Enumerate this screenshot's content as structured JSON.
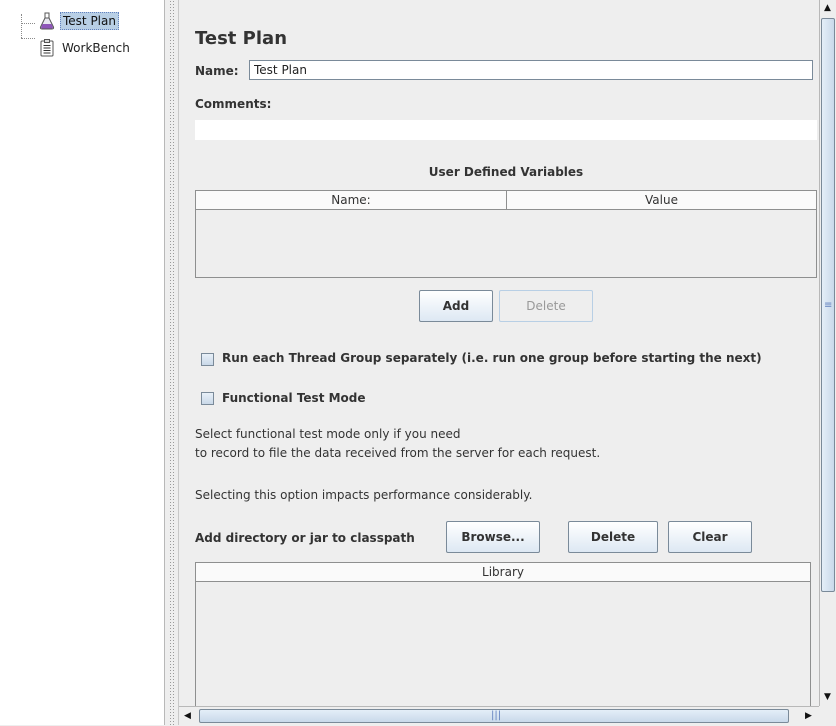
{
  "tree": {
    "items": [
      {
        "label": "Test Plan",
        "icon": "flask-icon",
        "selected": true
      },
      {
        "label": "WorkBench",
        "icon": "clipboard-icon",
        "selected": false
      }
    ]
  },
  "panel": {
    "title": "Test Plan",
    "name_label": "Name:",
    "name_value": "Test Plan",
    "comments_label": "Comments:",
    "comments_value": ""
  },
  "udv": {
    "title": "User Defined Variables",
    "columns": [
      "Name:",
      "Value"
    ],
    "rows": [],
    "add_label": "Add",
    "delete_label": "Delete"
  },
  "options": {
    "run_separately_label": "Run each Thread Group separately (i.e. run one group before starting the next)",
    "run_separately_checked": false,
    "functional_mode_label": "Functional Test Mode",
    "functional_mode_checked": false,
    "help_line1": "Select functional test mode only if you need",
    "help_line2": "to record to file the data received from the server for each request.",
    "help_line3": "Selecting this option impacts performance considerably."
  },
  "classpath": {
    "label": "Add directory or jar to classpath",
    "browse_label": "Browse...",
    "delete_label": "Delete",
    "clear_label": "Clear",
    "column": "Library",
    "rows": []
  },
  "colors": {
    "selection": "#b8cfe5",
    "selection_border": "#6382bf",
    "panel_bg": "#eeeeee",
    "button_gradient_end": "#dde8f3"
  }
}
